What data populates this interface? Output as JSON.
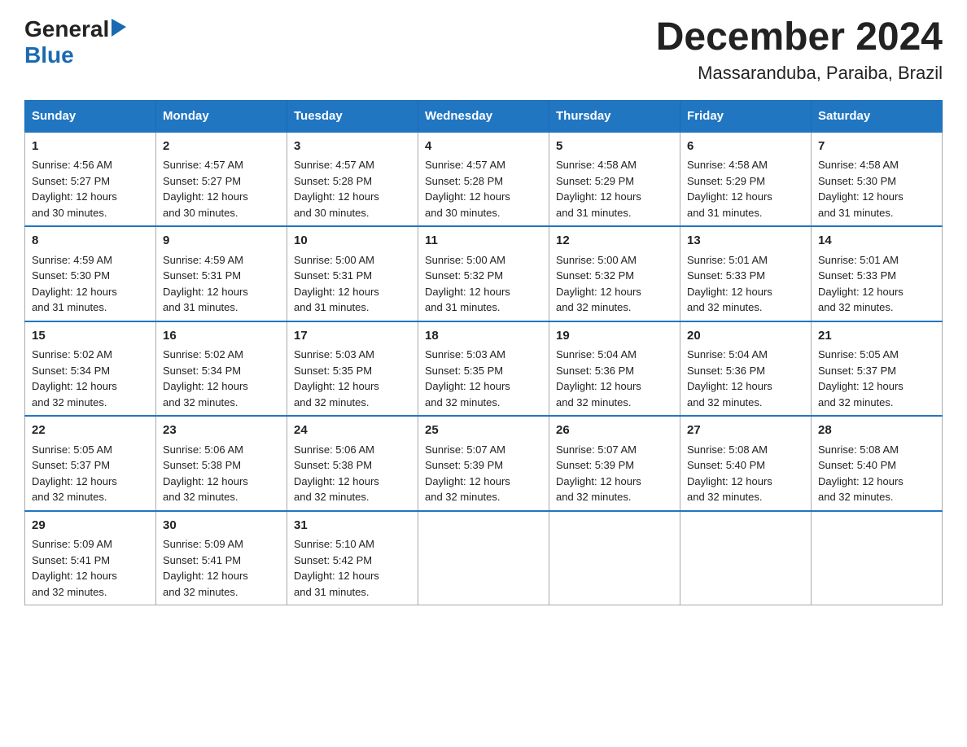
{
  "logo": {
    "general": "General",
    "blue": "Blue",
    "arrow": "▶"
  },
  "title": "December 2024",
  "subtitle": "Massaranduba, Paraiba, Brazil",
  "days_of_week": [
    "Sunday",
    "Monday",
    "Tuesday",
    "Wednesday",
    "Thursday",
    "Friday",
    "Saturday"
  ],
  "weeks": [
    [
      {
        "day": "1",
        "sunrise": "4:56 AM",
        "sunset": "5:27 PM",
        "daylight": "12 hours and 30 minutes."
      },
      {
        "day": "2",
        "sunrise": "4:57 AM",
        "sunset": "5:27 PM",
        "daylight": "12 hours and 30 minutes."
      },
      {
        "day": "3",
        "sunrise": "4:57 AM",
        "sunset": "5:28 PM",
        "daylight": "12 hours and 30 minutes."
      },
      {
        "day": "4",
        "sunrise": "4:57 AM",
        "sunset": "5:28 PM",
        "daylight": "12 hours and 30 minutes."
      },
      {
        "day": "5",
        "sunrise": "4:58 AM",
        "sunset": "5:29 PM",
        "daylight": "12 hours and 31 minutes."
      },
      {
        "day": "6",
        "sunrise": "4:58 AM",
        "sunset": "5:29 PM",
        "daylight": "12 hours and 31 minutes."
      },
      {
        "day": "7",
        "sunrise": "4:58 AM",
        "sunset": "5:30 PM",
        "daylight": "12 hours and 31 minutes."
      }
    ],
    [
      {
        "day": "8",
        "sunrise": "4:59 AM",
        "sunset": "5:30 PM",
        "daylight": "12 hours and 31 minutes."
      },
      {
        "day": "9",
        "sunrise": "4:59 AM",
        "sunset": "5:31 PM",
        "daylight": "12 hours and 31 minutes."
      },
      {
        "day": "10",
        "sunrise": "5:00 AM",
        "sunset": "5:31 PM",
        "daylight": "12 hours and 31 minutes."
      },
      {
        "day": "11",
        "sunrise": "5:00 AM",
        "sunset": "5:32 PM",
        "daylight": "12 hours and 31 minutes."
      },
      {
        "day": "12",
        "sunrise": "5:00 AM",
        "sunset": "5:32 PM",
        "daylight": "12 hours and 32 minutes."
      },
      {
        "day": "13",
        "sunrise": "5:01 AM",
        "sunset": "5:33 PM",
        "daylight": "12 hours and 32 minutes."
      },
      {
        "day": "14",
        "sunrise": "5:01 AM",
        "sunset": "5:33 PM",
        "daylight": "12 hours and 32 minutes."
      }
    ],
    [
      {
        "day": "15",
        "sunrise": "5:02 AM",
        "sunset": "5:34 PM",
        "daylight": "12 hours and 32 minutes."
      },
      {
        "day": "16",
        "sunrise": "5:02 AM",
        "sunset": "5:34 PM",
        "daylight": "12 hours and 32 minutes."
      },
      {
        "day": "17",
        "sunrise": "5:03 AM",
        "sunset": "5:35 PM",
        "daylight": "12 hours and 32 minutes."
      },
      {
        "day": "18",
        "sunrise": "5:03 AM",
        "sunset": "5:35 PM",
        "daylight": "12 hours and 32 minutes."
      },
      {
        "day": "19",
        "sunrise": "5:04 AM",
        "sunset": "5:36 PM",
        "daylight": "12 hours and 32 minutes."
      },
      {
        "day": "20",
        "sunrise": "5:04 AM",
        "sunset": "5:36 PM",
        "daylight": "12 hours and 32 minutes."
      },
      {
        "day": "21",
        "sunrise": "5:05 AM",
        "sunset": "5:37 PM",
        "daylight": "12 hours and 32 minutes."
      }
    ],
    [
      {
        "day": "22",
        "sunrise": "5:05 AM",
        "sunset": "5:37 PM",
        "daylight": "12 hours and 32 minutes."
      },
      {
        "day": "23",
        "sunrise": "5:06 AM",
        "sunset": "5:38 PM",
        "daylight": "12 hours and 32 minutes."
      },
      {
        "day": "24",
        "sunrise": "5:06 AM",
        "sunset": "5:38 PM",
        "daylight": "12 hours and 32 minutes."
      },
      {
        "day": "25",
        "sunrise": "5:07 AM",
        "sunset": "5:39 PM",
        "daylight": "12 hours and 32 minutes."
      },
      {
        "day": "26",
        "sunrise": "5:07 AM",
        "sunset": "5:39 PM",
        "daylight": "12 hours and 32 minutes."
      },
      {
        "day": "27",
        "sunrise": "5:08 AM",
        "sunset": "5:40 PM",
        "daylight": "12 hours and 32 minutes."
      },
      {
        "day": "28",
        "sunrise": "5:08 AM",
        "sunset": "5:40 PM",
        "daylight": "12 hours and 32 minutes."
      }
    ],
    [
      {
        "day": "29",
        "sunrise": "5:09 AM",
        "sunset": "5:41 PM",
        "daylight": "12 hours and 32 minutes."
      },
      {
        "day": "30",
        "sunrise": "5:09 AM",
        "sunset": "5:41 PM",
        "daylight": "12 hours and 32 minutes."
      },
      {
        "day": "31",
        "sunrise": "5:10 AM",
        "sunset": "5:42 PM",
        "daylight": "12 hours and 31 minutes."
      },
      null,
      null,
      null,
      null
    ]
  ],
  "labels": {
    "sunrise": "Sunrise:",
    "sunset": "Sunset:",
    "daylight": "Daylight:"
  }
}
